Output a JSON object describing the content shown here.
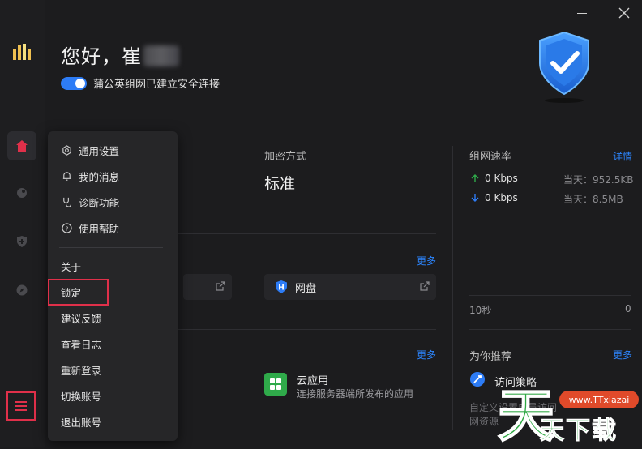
{
  "greeting": "您好，崔",
  "status_text": "蒲公英组网已建立安全连接",
  "encryption": {
    "label": "加密方式",
    "value": "标准"
  },
  "quick_access": {
    "more": "更多",
    "cards": [
      {
        "label": "网盘"
      }
    ]
  },
  "apps": {
    "more": "更多",
    "items": [
      {
        "name": "云应用",
        "desc": "连接服务器端所发布的应用"
      }
    ]
  },
  "network_speed": {
    "title": "组网速率",
    "details_link": "详情",
    "upload": {
      "value": "0 Kbps",
      "today": "当天：952.5KB"
    },
    "download": {
      "value": "0 Kbps",
      "today": "当天：8.5MB"
    },
    "axis_left": "10秒",
    "axis_right": "0"
  },
  "recommend": {
    "title": "为你推荐",
    "more": "更多",
    "item_title": "访问策略",
    "item_desc": "自定义设置成员访问",
    "item_desc2": "网资源"
  },
  "menu": {
    "items_icon": [
      {
        "label": "通用设置",
        "icon": "gear-icon"
      },
      {
        "label": "我的消息",
        "icon": "bell-icon"
      },
      {
        "label": "诊断功能",
        "icon": "stethoscope-icon"
      },
      {
        "label": "使用帮助",
        "icon": "help-icon"
      }
    ],
    "items_plain": [
      {
        "label": "关于"
      },
      {
        "label": "锁定"
      },
      {
        "label": "建议反馈"
      },
      {
        "label": "查看日志"
      },
      {
        "label": "重新登录"
      },
      {
        "label": "切换账号"
      },
      {
        "label": "退出账号"
      }
    ]
  },
  "watermark": {
    "url": "www.TTxiazai",
    "big": "天",
    "text": "天下载"
  },
  "colors": {
    "accent": "#2d7cf6",
    "highlight": "#e0304a",
    "app_green": "#2faa4a"
  }
}
